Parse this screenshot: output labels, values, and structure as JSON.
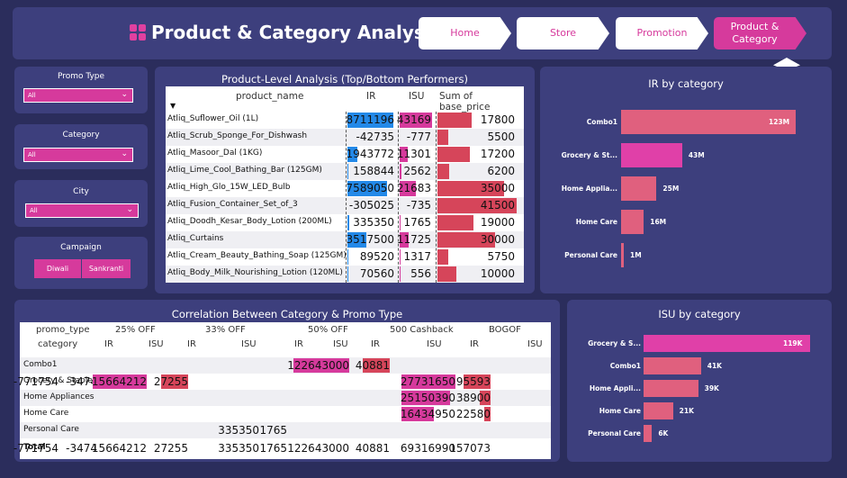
{
  "header": {
    "title": "Product & Category Analysis",
    "nav": [
      "Home",
      "Store",
      "Promotion",
      "Product & Category"
    ]
  },
  "slicers": {
    "promo_type": {
      "label": "Promo Type",
      "value": "All"
    },
    "category": {
      "label": "Category",
      "value": "All"
    },
    "city": {
      "label": "City",
      "value": "All"
    },
    "campaign": {
      "label": "Campaign",
      "options": [
        "Diwali",
        "Sankranti"
      ]
    }
  },
  "product_table": {
    "title": "Product-Level Analysis (Top/Bottom Performers)",
    "columns": [
      "product_name",
      "IR",
      "ISU",
      "Sum of base_price"
    ],
    "rows": [
      {
        "name": "Atliq_Suflower_Oil (1L)",
        "ir": "8711196",
        "isu": "43169",
        "price": "17800"
      },
      {
        "name": "Atliq_Scrub_Sponge_For_Dishwash",
        "ir": "-42735",
        "isu": "-777",
        "price": "5500"
      },
      {
        "name": "Atliq_Masoor_Dal (1KG)",
        "ir": "1943772",
        "isu": "11301",
        "price": "17200"
      },
      {
        "name": "Atliq_Lime_Cool_Bathing_Bar (125GM)",
        "ir": "158844",
        "isu": "2562",
        "price": "6200"
      },
      {
        "name": "Atliq_High_Glo_15W_LED_Bulb",
        "ir": "7589050",
        "isu": "21683",
        "price": "35000"
      },
      {
        "name": "Atliq_Fusion_Container_Set_of_3",
        "ir": "-305025",
        "isu": "-735",
        "price": "41500"
      },
      {
        "name": "Atliq_Doodh_Kesar_Body_Lotion (200ML)",
        "ir": "335350",
        "isu": "1765",
        "price": "19000"
      },
      {
        "name": "Atliq_Curtains",
        "ir": "3517500",
        "isu": "11725",
        "price": "30000"
      },
      {
        "name": "Atliq_Cream_Beauty_Bathing_Soap (125GM)",
        "ir": "89520",
        "isu": "1317",
        "price": "5750"
      },
      {
        "name": "Atliq_Body_Milk_Nourishing_Lotion (120ML)",
        "ir": "70560",
        "isu": "556",
        "price": "10000"
      }
    ]
  },
  "ir_chart": {
    "title": "IR by category",
    "chart_data": {
      "type": "bar",
      "categories": [
        "Combo1",
        "Grocery & St...",
        "Home Appliа...",
        "Home Care",
        "Personal Care"
      ],
      "values": [
        123,
        43,
        25,
        16,
        1
      ],
      "labels": [
        "123M",
        "43M",
        "25M",
        "16M",
        "1M"
      ],
      "colors": [
        "#e0607e",
        "#e040a8",
        "#e0607e",
        "#e0607e",
        "#e0607e"
      ]
    }
  },
  "isu_chart": {
    "title": "ISU by category",
    "chart_data": {
      "type": "bar",
      "categories": [
        "Grocery & S...",
        "Combo1",
        "Home Appli...",
        "Home Care",
        "Personal Care"
      ],
      "values": [
        119,
        41,
        39,
        21,
        6
      ],
      "labels": [
        "119K",
        "41K",
        "39K",
        "21K",
        "6K"
      ],
      "colors": [
        "#e040a8",
        "#e0607e",
        "#e0607e",
        "#e0607e",
        "#e0607e"
      ]
    }
  },
  "matrix": {
    "title": "Correlation Between Category & Promo Type",
    "row_header_top": "promo_type",
    "row_header_bottom": "category",
    "promo_types": [
      "25% OFF",
      "33% OFF",
      "50% OFF",
      "500 Cashback",
      "BOGOF"
    ],
    "sub": [
      "IR",
      "ISU"
    ],
    "rows": [
      {
        "cat": "Combo1",
        "vals": [
          "",
          "",
          "",
          "",
          "",
          "",
          "122643000",
          "40881",
          "",
          ""
        ]
      },
      {
        "cat": "Grocery & Staples",
        "vals": [
          "-771754",
          "-3474",
          "15664212",
          "27255",
          "",
          "",
          "",
          "",
          "27731650",
          "95593"
        ]
      },
      {
        "cat": "Home Appliances",
        "vals": [
          "",
          "",
          "",
          "",
          "",
          "",
          "",
          "",
          "25150390",
          "38900"
        ]
      },
      {
        "cat": "Home Care",
        "vals": [
          "",
          "",
          "",
          "",
          "",
          "",
          "",
          "",
          "16434950",
          "22580"
        ]
      },
      {
        "cat": "Personal Care",
        "vals": [
          "",
          "",
          "",
          "",
          "335350",
          "1765",
          "",
          "",
          "",
          ""
        ]
      }
    ],
    "total": {
      "cat": "Total",
      "vals": [
        "-771754",
        "-3474",
        "15664212",
        "27255",
        "335350",
        "1765",
        "122643000",
        "40881",
        "69316990",
        "157073"
      ]
    }
  }
}
